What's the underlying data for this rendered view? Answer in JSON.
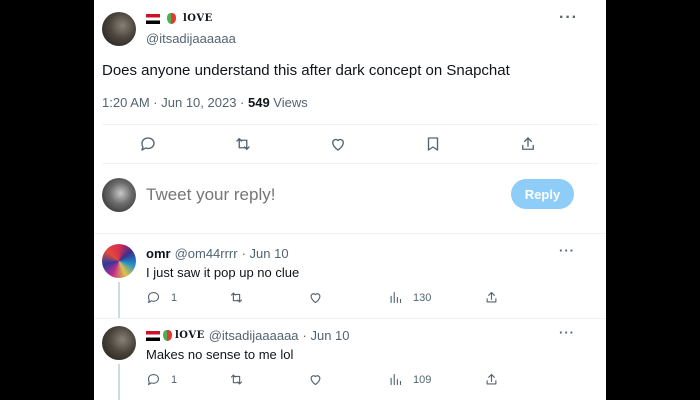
{
  "tweet": {
    "display_name": "🇾🇪 ❤️ lOVE",
    "love_text": "lOVE",
    "handle": "@itsadijaaaaaa",
    "text": "Does anyone understand this after dark concept on Snapchat",
    "time": "1:20 AM · Jun 10, 2023 · ",
    "views_count": "549",
    "views_label": " Views",
    "more_label": "···"
  },
  "reply_box": {
    "placeholder": "Tweet your reply!",
    "button_label": "Reply"
  },
  "replies": [
    {
      "name": "omr",
      "handle": "@om44rrrr",
      "date": "· Jun 10",
      "text": "I just saw it pop up no clue",
      "replies_count": "1",
      "views_count": "130",
      "more_label": "···"
    },
    {
      "love_text": "lOVE",
      "handle": "@itsadijaaaaaa",
      "date": "· Jun 10",
      "text": "Makes no sense to me lol",
      "replies_count": "1",
      "views_count": "109",
      "more_label": "···"
    }
  ],
  "colors": {
    "accent_disabled": "#8ecdf8",
    "secondary_text": "#536471",
    "divider": "#eff3f4"
  },
  "icons": [
    "reply-icon",
    "retweet-icon",
    "like-icon",
    "bookmark-icon",
    "share-icon",
    "views-icon",
    "more-icon"
  ]
}
